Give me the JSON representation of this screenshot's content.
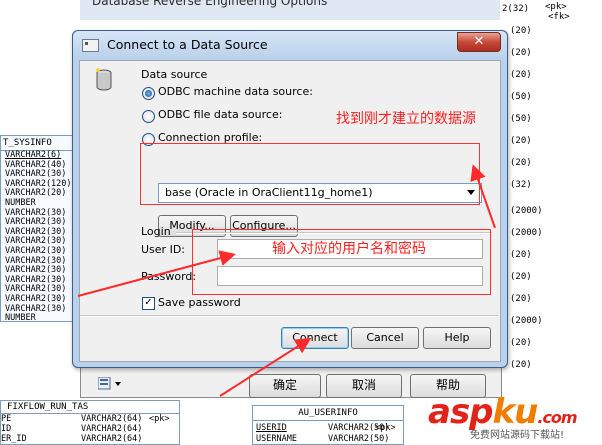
{
  "background": {
    "window_title": "Database Reverse Engineering Options",
    "sysinfo_table": {
      "title": "T_SYSINFO",
      "rows": [
        "VARCHAR2(6)",
        "VARCHAR2(40)",
        "VARCHAR2(30)",
        "VARCHAR2(120)",
        "VARCHAR2(20)",
        "NUMBER",
        "VARCHAR2(30)",
        "VARCHAR2(30)",
        "VARCHAR2(30)",
        "VARCHAR2(30)",
        "VARCHAR2(30)",
        "VARCHAR2(30)",
        "VARCHAR2(30)",
        "VARCHAR2(30)",
        "VARCHAR2(30)",
        "VARCHAR2(30)",
        "VARCHAR2(30)",
        "NUMBER"
      ]
    },
    "right_column": [
      "2(32)",
      "(20)",
      "(20)",
      "(20)",
      "(50)",
      "(50)",
      "(20)",
      "(20)",
      "(32)",
      "(2000)",
      "(2000)",
      "(20)",
      "(20)",
      "(20)",
      "(2000)",
      "(20)",
      "(20)"
    ],
    "right_tags": [
      "<pk>",
      "<fk>"
    ],
    "fixflow_table": {
      "title": "FIXFLOW_RUN_TAS",
      "rows": [
        {
          "left": "PE",
          "type": "VARCHAR2(64)",
          "tag": "<pk>"
        },
        {
          "left": "ID",
          "type": "VARCHAR2(64)",
          "tag": ""
        },
        {
          "left": "ER_ID",
          "type": "VARCHAR2(64)",
          "tag": ""
        }
      ]
    },
    "au_userinfo_table": {
      "title": "AU_USERINFO",
      "rows": [
        {
          "col": "USERID",
          "type": "VARCHAR2(50)",
          "tag": "<pk>"
        },
        {
          "col": "USERNAME",
          "type": "VARCHAR2(50)",
          "tag": ""
        }
      ]
    },
    "parent_buttons": {
      "ok": "确定",
      "cancel": "取消",
      "help": "帮助"
    }
  },
  "dialog": {
    "title": "Connect to a Data Source",
    "close_glyph": "✕",
    "data_source_label": "Data source",
    "odbc_machine_label": "ODBC machine data source:",
    "odbc_file_label": "ODBC file data source:",
    "connection_profile_label": "Connection profile:",
    "selected_source": "base (Oracle in OraClient11g_home1)",
    "modify_label": "Modify...",
    "configure_label": "Configure...",
    "login_label": "Login",
    "user_id_label": "User ID:",
    "user_id_value": "",
    "password_label": "Password:",
    "password_value": "",
    "save_password_label": "Save password",
    "save_password_checked": true,
    "connect_label": "Connect",
    "cancel_label": "Cancel",
    "help_label": "Help"
  },
  "annotations": {
    "find_source": "找到刚才建立的数据源",
    "enter_credentials": "输入对应的用户名和密码",
    "color": "#ff2020"
  },
  "watermark": {
    "asp": "asp",
    "ku": "ku",
    "dot": ".",
    "com": "com",
    "subtitle": "免费网站源码下载站!"
  }
}
